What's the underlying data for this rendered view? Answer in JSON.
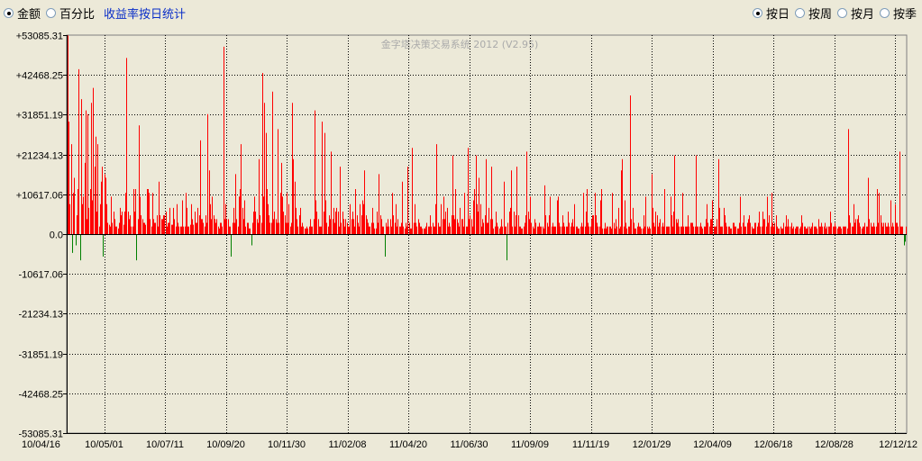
{
  "toolbar": {
    "left_options": [
      {
        "label": "金额",
        "checked": true
      },
      {
        "label": "百分比",
        "checked": false
      }
    ],
    "link_label": "收益率按日统计",
    "right_options": [
      {
        "label": "按日",
        "checked": true
      },
      {
        "label": "按周",
        "checked": false
      },
      {
        "label": "按月",
        "checked": false
      },
      {
        "label": "按季",
        "checked": false
      }
    ]
  },
  "chart_data": {
    "type": "bar",
    "watermark": "金字塔决策交易系统 2012 (V2.95)",
    "ylim": [
      -53085.31,
      53085.31
    ],
    "y_ticks": [
      {
        "label": "+53085.31",
        "value": 53085.31
      },
      {
        "label": "+42468.25",
        "value": 42468.25
      },
      {
        "label": "+31851.19",
        "value": 31851.19
      },
      {
        "label": "+21234.13",
        "value": 21234.13
      },
      {
        "label": "+10617.06",
        "value": 10617.06
      },
      {
        "label": "0.0",
        "value": 0
      },
      {
        "label": "-10617.06",
        "value": -10617.06
      },
      {
        "label": "-21234.13",
        "value": -21234.13
      },
      {
        "label": "-31851.19",
        "value": -31851.19
      },
      {
        "label": "-42468.25",
        "value": -42468.25
      },
      {
        "label": "-53085.31",
        "value": -53085.31
      }
    ],
    "x_ticks": [
      "10/04/16",
      "10/05/01",
      "10/07/11",
      "10/09/20",
      "10/11/30",
      "11/02/08",
      "11/04/20",
      "11/06/30",
      "11/09/09",
      "11/11/19",
      "12/01/29",
      "12/04/09",
      "12/06/18",
      "12/08/28",
      "12/12/12"
    ],
    "grid": true,
    "colors": {
      "positive": "#ff0000",
      "negative": "#008000",
      "plot_bg": "#ece9d8",
      "grid": "#000000"
    },
    "values": [
      53000,
      30000,
      8000,
      24000,
      -5000,
      11000,
      15000,
      -3000,
      5000,
      12000,
      44000,
      -7000,
      36000,
      8000,
      10000,
      19000,
      33000,
      4000,
      32000,
      7000,
      12000,
      35000,
      9000,
      39000,
      18000,
      26000,
      6000,
      24000,
      2000,
      8000,
      14000,
      18000,
      -6000,
      16000,
      15000,
      8000,
      3000,
      2500,
      2000,
      10000,
      3000,
      6000,
      4000,
      2000,
      2000,
      1500,
      3000,
      7000,
      5000,
      6000,
      2500,
      6000,
      11000,
      47000,
      6000,
      4000,
      5000,
      2000,
      2000,
      12000,
      6000,
      12000,
      -7000,
      4000,
      29000,
      10000,
      5000,
      4000,
      3000,
      3000,
      2500,
      12000,
      12000,
      11000,
      4000,
      2000,
      11000,
      4000,
      3000,
      3000,
      5000,
      2000,
      14000,
      5000,
      4000,
      4000,
      5000,
      5000,
      6000,
      2000,
      3000,
      3000,
      7000,
      2500,
      2500,
      7000,
      4000,
      2000,
      8000,
      3000,
      2000,
      2000,
      2000,
      9000,
      2000,
      2000,
      11000,
      7000,
      2000,
      2000,
      2500,
      8000,
      4000,
      2500,
      6000,
      3000,
      3000,
      7000,
      5000,
      25000,
      4000,
      4000,
      3000,
      2000,
      5000,
      3000,
      32000,
      17000,
      8000,
      4000,
      10000,
      5000,
      4000,
      3000,
      4000,
      2000,
      1500,
      3000,
      3000,
      2000,
      50000,
      4000,
      8000,
      4000,
      4000,
      2000,
      2000,
      -6000,
      3000,
      7000,
      3000,
      16000,
      4000,
      2000,
      10000,
      12000,
      24000,
      7000,
      4000,
      9000,
      2000,
      3000,
      3000,
      1500,
      1500,
      -3000,
      3000,
      6000,
      10000,
      6000,
      4000,
      3000,
      20000,
      5000,
      3000,
      43000,
      10000,
      35000,
      27000,
      12000,
      8000,
      5000,
      3000,
      3000,
      38000,
      4000,
      6000,
      4000,
      3000,
      28000,
      3000,
      11000,
      19000,
      10000,
      6000,
      5000,
      3000,
      11000,
      3000,
      8000,
      2000,
      3000,
      35000,
      20000,
      14000,
      7000,
      4000,
      2000,
      5000,
      7000,
      2000,
      3000,
      2000,
      1500,
      1500,
      2000,
      1500,
      2000,
      4000,
      2000,
      2000,
      4000,
      33000,
      9000,
      6000,
      4000,
      2000,
      2000,
      2000,
      30000,
      6000,
      27000,
      9000,
      3000,
      2000,
      5000,
      4000,
      22000,
      4000,
      7000,
      3000,
      6000,
      7000,
      6000,
      2000,
      18000,
      3000,
      6000,
      4000,
      2000,
      4000,
      3000,
      2000,
      2000,
      8000,
      4000,
      6000,
      4000,
      2000,
      12000,
      5000,
      3000,
      2000,
      8000,
      5000,
      9000,
      8000,
      17000,
      5000,
      4000,
      3000,
      2000,
      2000,
      3000,
      7000,
      3000,
      1500,
      1500,
      6000,
      3000,
      16000,
      5000,
      4000,
      2000,
      2000,
      -6000,
      3000,
      2000,
      4000,
      2000,
      4000,
      2000,
      11000,
      5000,
      3000,
      8000,
      2000,
      4000,
      2000,
      2000,
      3000,
      14000,
      2000,
      1500,
      3000,
      2000,
      18000,
      3000,
      1500,
      1500,
      23000,
      3000,
      8000,
      3000,
      2000,
      4000,
      3000,
      2000,
      2000,
      1500,
      1500,
      1500,
      2000,
      3000,
      2000,
      2000,
      5000,
      2000,
      3000,
      2000,
      2000,
      8000,
      24000,
      3000,
      2000,
      2000,
      8000,
      4000,
      10000,
      4000,
      6000,
      7000,
      2000,
      3000,
      2000,
      5000,
      21000,
      5000,
      4000,
      12000,
      4000,
      3000,
      2000,
      7000,
      4000,
      4000,
      2000,
      11000,
      2000,
      2000,
      23000,
      4000,
      5000,
      4000,
      2000,
      9000,
      12000,
      21000,
      8000,
      6000,
      15000,
      8000,
      2000,
      4000,
      3000,
      5000,
      20000,
      3000,
      3000,
      7000,
      4000,
      18000,
      4000,
      1500,
      2000,
      6000,
      3000,
      2000,
      1500,
      2000,
      4000,
      2000,
      14000,
      2000,
      2000,
      -7000,
      3000,
      6000,
      7000,
      17000,
      2000,
      6000,
      2000,
      5000,
      18000,
      5000,
      2000,
      2000,
      1500,
      1500,
      2000,
      3000,
      5000,
      22000,
      6000,
      4000,
      10000,
      3000,
      2000,
      1500,
      4000,
      3000,
      2000,
      2000,
      3000,
      2000,
      2000,
      2000,
      1500,
      13000,
      5000,
      3000,
      2000,
      5000,
      10000,
      2000,
      3000,
      2000,
      2000,
      2000,
      9000,
      10000,
      3000,
      2000,
      2000,
      5000,
      3000,
      2000,
      2000,
      2000,
      6000,
      3000,
      2000,
      3000,
      4000,
      2000,
      8000,
      2000,
      2000,
      1500,
      1500,
      2000,
      3000,
      2000,
      11000,
      2000,
      6000,
      12000,
      3000,
      2000,
      2000,
      4000,
      5000,
      5000,
      11000,
      5000,
      3000,
      2000,
      2000,
      9000,
      12000,
      1500,
      1500,
      3000,
      1500,
      2000,
      2000,
      2000,
      2000,
      1500,
      11000,
      3000,
      1500,
      4000,
      2000,
      7000,
      1500,
      2000,
      17000,
      20000,
      2000,
      9000,
      3000,
      1500,
      2000,
      2000,
      37000,
      4000,
      7000,
      3000,
      1500,
      1500,
      2000,
      3000,
      2000,
      2000,
      1500,
      1500,
      5000,
      2000,
      10000,
      2000,
      1500,
      2000,
      1500,
      16000,
      7000,
      3000,
      2000,
      6000,
      5000,
      2000,
      3000,
      4000,
      2000,
      3000,
      2000,
      12000,
      2000,
      2000,
      2000,
      2000,
      10000,
      5000,
      2000,
      6000,
      21000,
      4000,
      3000,
      4000,
      2000,
      2000,
      2000,
      11000,
      2000,
      2000,
      2000,
      2000,
      5000,
      2000,
      3000,
      3000,
      3000,
      2000,
      2000,
      21000,
      2000,
      2000,
      2000,
      3000,
      2000,
      1500,
      2000,
      2000,
      4000,
      8000,
      3000,
      2000,
      4000,
      4000,
      9000,
      2000,
      2000,
      2000,
      4000,
      20000,
      7000,
      2000,
      2000,
      2000,
      7000,
      5000,
      3000,
      2000,
      2000,
      2000,
      1500,
      1500,
      3000,
      3000,
      2000,
      2000,
      1500,
      1500,
      3000,
      10000,
      2000,
      3000,
      5000,
      2000,
      2000,
      3000,
      4000,
      5000,
      3000,
      2000,
      1500,
      1500,
      3000,
      3000,
      2000,
      3000,
      6000,
      2000,
      2000,
      6000,
      4000,
      4000,
      2000,
      10000,
      3000,
      5000,
      2000,
      11000,
      3000,
      2000,
      3000,
      5000,
      2000,
      1500,
      1500,
      2000,
      1500,
      1500,
      3000,
      2000,
      5000,
      2000,
      4000,
      2000,
      2000,
      3000,
      1500,
      2000,
      1500,
      2000,
      2000,
      2000,
      1500,
      2000,
      5000,
      3000,
      2000,
      2000,
      1500,
      1500,
      2000,
      2000,
      1500,
      2000,
      3000,
      2000,
      2000,
      2000,
      1500,
      4000,
      2000,
      2000,
      3000,
      2000,
      2000,
      3000,
      1500,
      2000,
      2000,
      2000,
      6000,
      3000,
      2000,
      2000,
      3000,
      2000,
      1500,
      2000,
      2000,
      2000,
      1500,
      2000,
      2000,
      2000,
      2000,
      1500,
      28000,
      5000,
      3000,
      2000,
      2000,
      8000,
      3000,
      4000,
      4000,
      5000,
      3000,
      2000,
      1500,
      2000,
      2000,
      3000,
      2000,
      2000,
      15000,
      4000,
      3000,
      2000,
      2000,
      3000,
      2000,
      2000,
      12000,
      3000,
      11000,
      5000,
      3000,
      2000,
      3000,
      3000,
      2000,
      2000,
      3000,
      2000,
      9000,
      2000,
      3000,
      2000,
      8000,
      3000,
      3000,
      2000,
      22000,
      2000,
      2000,
      2000,
      -3000,
      -2000,
      2000
    ]
  }
}
